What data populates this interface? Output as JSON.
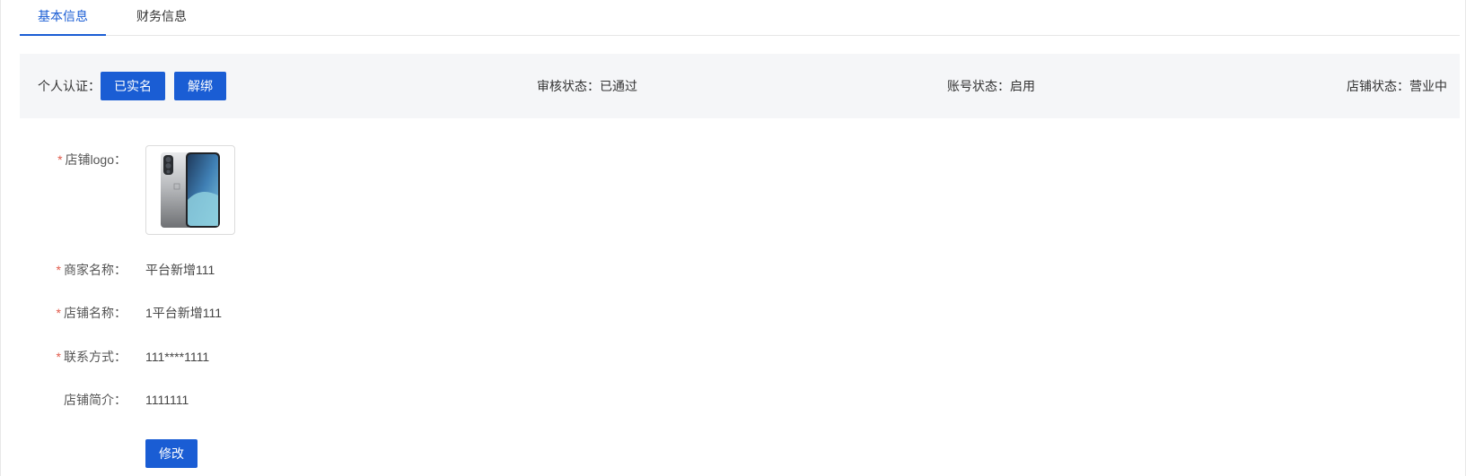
{
  "tabs": [
    {
      "label": "基本信息",
      "active": true
    },
    {
      "label": "财务信息",
      "active": false
    }
  ],
  "status_bar": {
    "auth_label": "个人认证：",
    "verified_button": "已实名",
    "unbind_button": "解绑",
    "review_status": "审核状态：已通过",
    "account_status": "账号状态：启用",
    "shop_status": "店铺状态：营业中"
  },
  "form": {
    "required_mark": "*",
    "logo_label": "店铺logo：",
    "merchant_name_label": "商家名称：",
    "merchant_name_value": "平台新增111",
    "shop_name_label": "店铺名称：",
    "shop_name_value": "1平台新增111",
    "contact_label": "联系方式：",
    "contact_value": "111****1111",
    "intro_label": "店铺简介：",
    "intro_value": "1111111",
    "edit_button": "修改"
  },
  "colors": {
    "accent": "#1a5dd4",
    "required": "#e05a4b",
    "status_bg": "#f5f6f8"
  }
}
